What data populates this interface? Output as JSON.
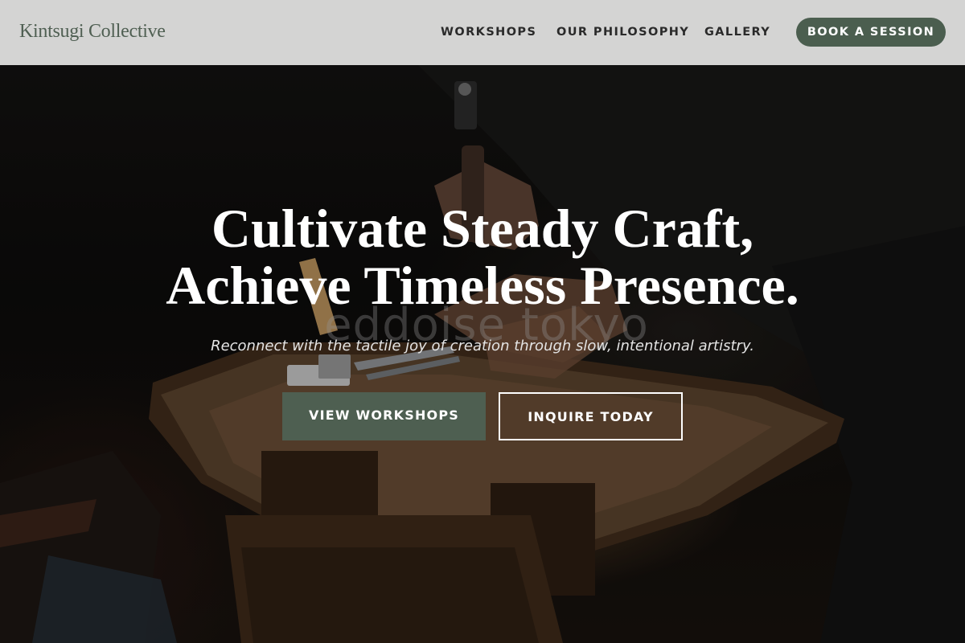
{
  "brand": {
    "name": "Kintsugi Collective"
  },
  "nav": {
    "links": [
      "WORKSHOPS",
      "OUR PHILOSOPHY",
      "GALLERY"
    ],
    "cta_label": "BOOK A SESSION"
  },
  "hero": {
    "headline_line1": "Cultivate Steady Craft,",
    "headline_line2": "Achieve Timeless Presence.",
    "subtitle": "Reconnect with the tactile joy of creation through slow, intentional artistry.",
    "primary_cta": "VIEW WORKSHOPS",
    "secondary_cta": "INQUIRE TODAY",
    "image_watermark": "eddoise tokyo"
  },
  "colors": {
    "accent": "#4b5e4f",
    "nav_background": "#d4d4d3",
    "nav_text": "#2a2a2a",
    "brand_text": "#4f5f52",
    "hero_text": "#ffffff"
  }
}
